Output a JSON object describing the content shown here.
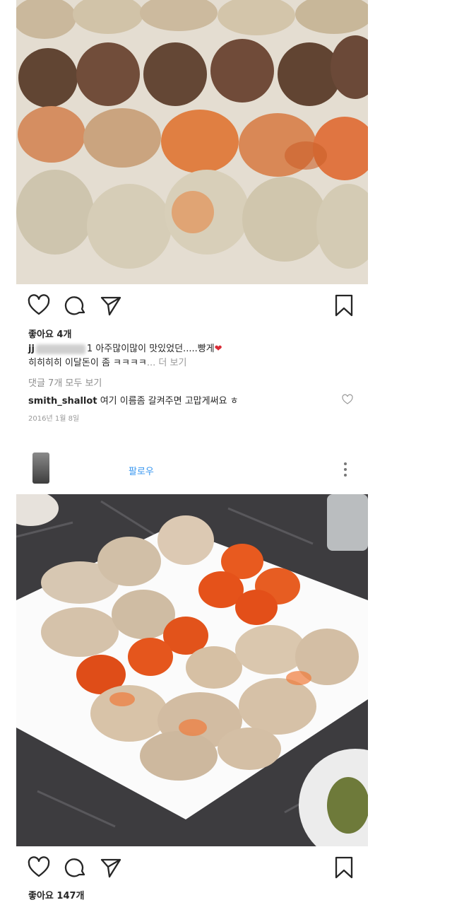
{
  "posts": [
    {
      "image": {
        "description_icon": "seasoned-crab-photo"
      },
      "likes": "좋아요 4개",
      "caption": {
        "user": "jj",
        "text_line1": "1 아주많이많이 맛있었던.....빵게",
        "heart": "❤",
        "text_line2": "히히히히 이달돈이 좀 ㅋㅋㅋㅋ",
        "more": "... 더 보기"
      },
      "view_comments": "댓글 7개 모두 보기",
      "comment": {
        "user": "smith_shallot",
        "text": "여기 이름좀 갈켜주면 고맙게써요 ㅎ"
      },
      "date": "2016년 1월 8일"
    },
    {
      "header": {
        "follow_label": "팔로우"
      },
      "image": {
        "description_icon": "crab-platter-photo"
      },
      "likes": "좋아요 147개"
    }
  ],
  "icons": {
    "like": "heart-icon",
    "comment": "comment-icon",
    "share": "send-icon",
    "save": "bookmark-icon",
    "more": "more-options-icon"
  },
  "colors": {
    "link": "#3897f0",
    "heart": "#d92b36",
    "text": "#262626",
    "muted": "#8e8e8e"
  }
}
